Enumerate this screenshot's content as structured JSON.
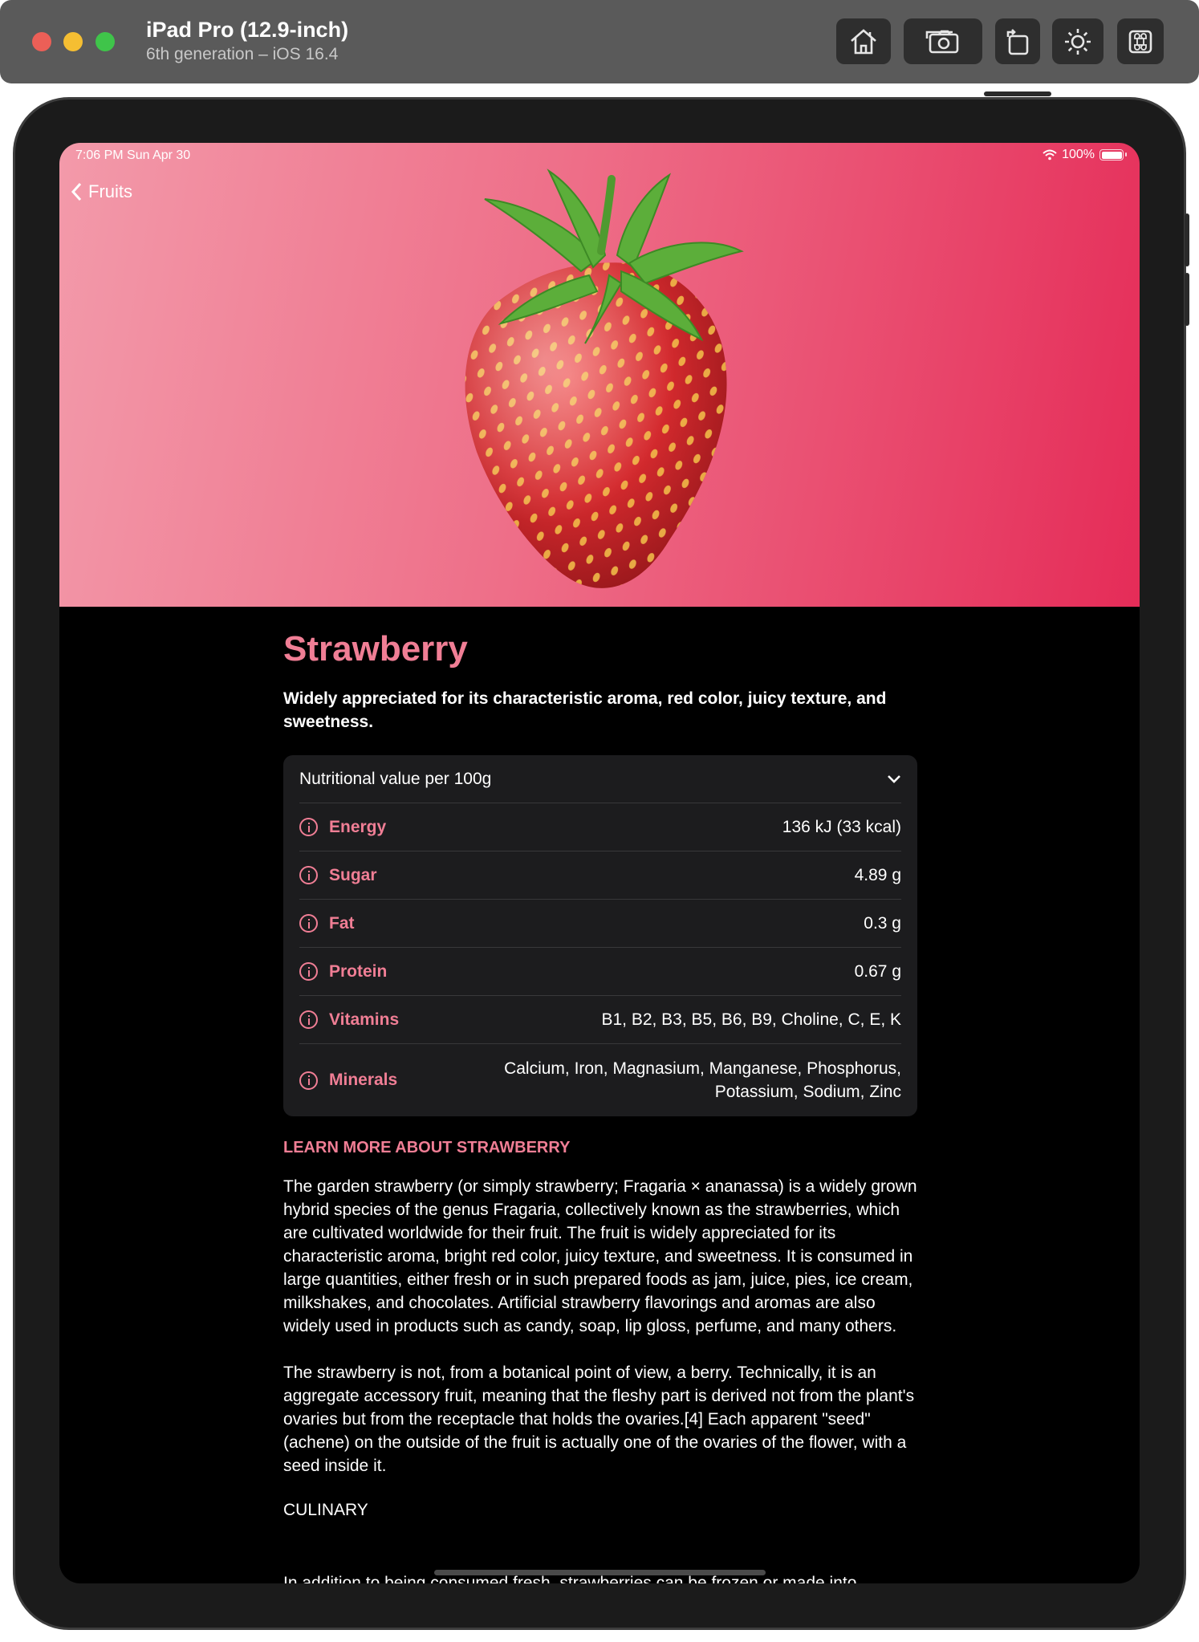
{
  "simulator": {
    "title": "iPad Pro (12.9-inch)",
    "subtitle": "6th generation – iOS 16.4",
    "tools": [
      "home-icon",
      "screenshot-icon",
      "rotate-icon",
      "appearance-icon",
      "command-icon"
    ]
  },
  "status_bar": {
    "time": "7:06 PM   Sun Apr 30",
    "battery": "100%"
  },
  "nav": {
    "back_label": "Fruits"
  },
  "fruit": {
    "title": "Strawberry",
    "headline": "Widely appreciated for its characteristic aroma,  red color, juicy texture, and sweetness.",
    "accent_color": "#f07e95"
  },
  "nutrition": {
    "header": "Nutritional value per 100g",
    "rows": [
      {
        "label": "Energy",
        "value": "136 kJ (33 kcal)"
      },
      {
        "label": "Sugar",
        "value": "4.89 g"
      },
      {
        "label": "Fat",
        "value": "0.3 g"
      },
      {
        "label": "Protein",
        "value": "0.67 g"
      },
      {
        "label": "Vitamins",
        "value": "B1, B2, B3, B5, B6, B9, Choline, C, E, K"
      },
      {
        "label": "Minerals",
        "value": "Calcium, Iron, Magnasium, Manganese, Phosphorus, Potassium, Sodium, Zinc"
      }
    ]
  },
  "learn_more": {
    "heading": "LEARN MORE ABOUT STRAWBERRY",
    "paragraphs": [
      "The garden strawberry (or simply strawberry; Fragaria × ananassa) is a widely grown hybrid species of the genus Fragaria, collectively known as the strawberries, which are cultivated worldwide for their fruit. The fruit is widely appreciated for its characteristic aroma, bright red color, juicy texture, and sweetness. It is consumed in large quantities, either fresh or in such prepared foods as jam, juice, pies, ice cream, milkshakes, and chocolates. Artificial strawberry flavorings and aromas are also widely used in products such as candy, soap, lip gloss, perfume, and many others.",
      "The strawberry is not, from a botanical point of view, a berry. Technically, it is an aggregate accessory fruit, meaning that the fleshy part is derived not from the plant's ovaries but from the receptacle that holds the ovaries.[4] Each apparent \"seed\" (achene) on the outside of the fruit is actually one of the ovaries of the flower, with a seed inside it."
    ],
    "subheading": "CULINARY",
    "cut_line": "In addition to being consumed fresh, strawberries can be frozen or made into"
  }
}
